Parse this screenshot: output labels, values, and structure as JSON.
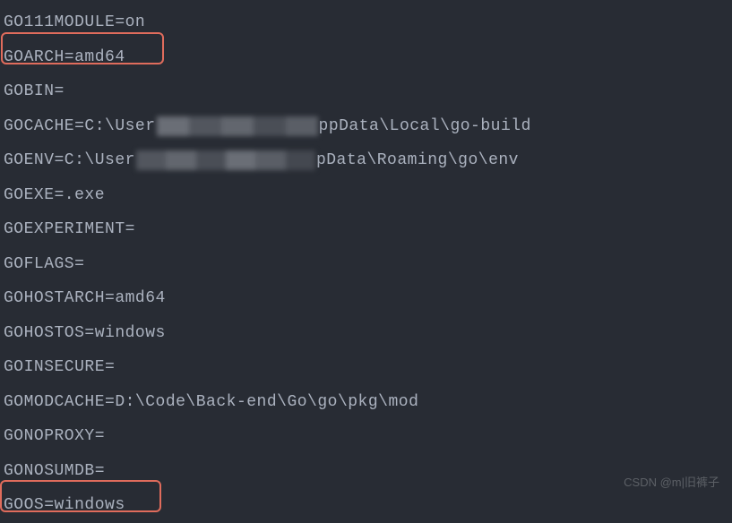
{
  "env": {
    "go111module": "GO111MODULE=on",
    "goarch": "GOARCH=amd64",
    "gobin": "GOBIN=",
    "gocache_prefix": "GOCACHE=C:\\User",
    "gocache_suffix": "ppData\\Local\\go-build",
    "goenv_prefix": "GOENV=C:\\User",
    "goenv_suffix": "pData\\Roaming\\go\\env",
    "goexe": "GOEXE=.exe",
    "goexperiment": "GOEXPERIMENT=",
    "goflags": "GOFLAGS=",
    "gohostarch": "GOHOSTARCH=amd64",
    "gohostos": "GOHOSTOS=windows",
    "goinsecure": "GOINSECURE=",
    "gomodcache": "GOMODCACHE=D:\\Code\\Back-end\\Go\\go\\pkg\\mod",
    "gonoproxy": "GONOPROXY=",
    "gonosumdb": "GONOSUMDB=",
    "goos": "GOOS=windows"
  },
  "watermark": "CSDN @m|旧裤子"
}
